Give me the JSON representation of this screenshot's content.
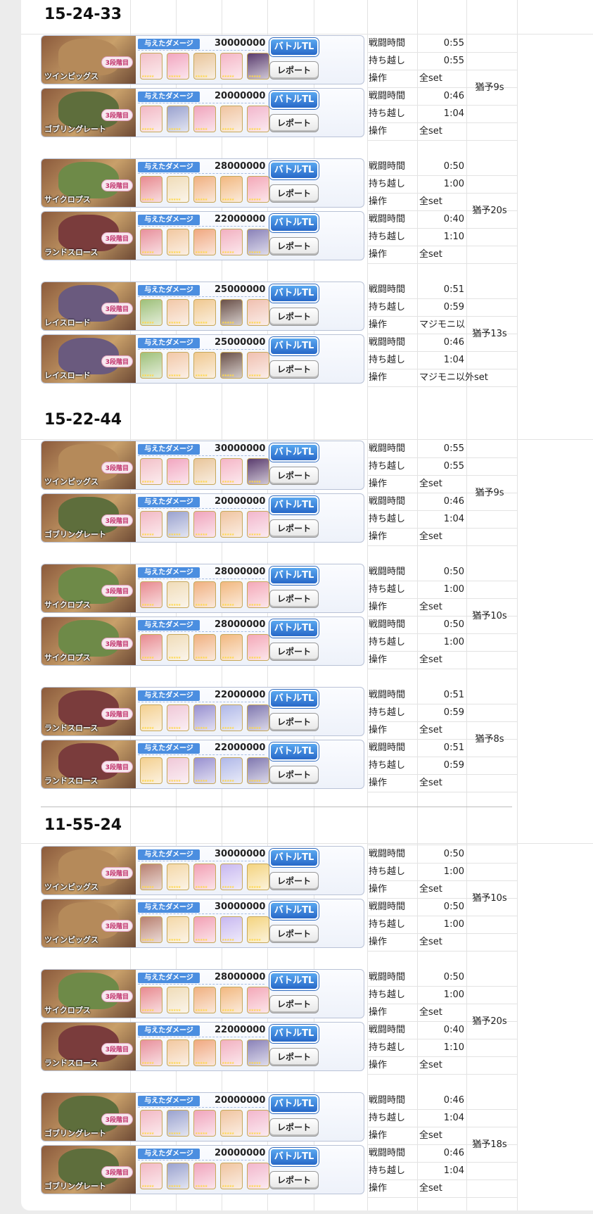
{
  "blocks": [
    {
      "title": "15-24-33",
      "groups": [
        {
          "note": "猶予9s",
          "entries": [
            {
              "boss": "ツインピッグス",
              "stage": "3段階目",
              "damage_label": "与えたダメージ",
              "damage": "30000000",
              "tl_label": "バトルTL",
              "report_label": "レポート",
              "labels": [
                "戦闘時間",
                "持ち越し",
                "操作"
              ],
              "battle_time": "0:55",
              "carryover": "0:55",
              "operation": "全set",
              "boss_color": "#b58a5a",
              "chars": [
                "#f3c0c8",
                "#f2a6c0",
                "#e9c59a",
                "#f5b5c6",
                "#5a3c6e"
              ]
            },
            {
              "boss": "ゴブリングレート",
              "stage": "3段階目",
              "damage_label": "与えたダメージ",
              "damage": "20000000",
              "tl_label": "バトルTL",
              "report_label": "レポート",
              "labels": [
                "戦闘時間",
                "持ち越し",
                "操作"
              ],
              "battle_time": "0:46",
              "carryover": "1:04",
              "operation": "全set",
              "boss_color": "#5e6e3c",
              "chars": [
                "#f2b8c4",
                "#9aa2cf",
                "#f0a4bc",
                "#f0c4a0",
                "#f2b6cc"
              ]
            }
          ]
        },
        {
          "note": "猶予20s",
          "entries": [
            {
              "boss": "サイクロプス",
              "stage": "3段階目",
              "damage_label": "与えたダメージ",
              "damage": "28000000",
              "tl_label": "バトルTL",
              "report_label": "レポート",
              "labels": [
                "戦闘時間",
                "持ち越し",
                "操作"
              ],
              "battle_time": "0:50",
              "carryover": "1:00",
              "operation": "全set",
              "boss_color": "#6e8a48",
              "chars": [
                "#e88a90",
                "#f0dcb8",
                "#f0b080",
                "#f2b880",
                "#f4a8b8"
              ]
            },
            {
              "boss": "ランドスロース",
              "stage": "3段階目",
              "damage_label": "与えたダメージ",
              "damage": "22000000",
              "tl_label": "バトルTL",
              "report_label": "レポート",
              "labels": [
                "戦闘時間",
                "持ち越し",
                "操作"
              ],
              "battle_time": "0:40",
              "carryover": "1:10",
              "operation": "全set",
              "boss_color": "#7a3c3c",
              "chars": [
                "#e8909c",
                "#f2c8a0",
                "#f0a880",
                "#f2b0c0",
                "#8a82b8"
              ]
            }
          ]
        },
        {
          "note": "猶予13s",
          "entries": [
            {
              "boss": "レイスロード",
              "stage": "3段階目",
              "damage_label": "与えたダメージ",
              "damage": "25000000",
              "tl_label": "バトルTL",
              "report_label": "レポート",
              "labels": [
                "戦闘時間",
                "持ち越し",
                "操作"
              ],
              "battle_time": "0:51",
              "carryover": "0:59",
              "operation": "マジモニ以",
              "boss_color": "#6a5a7e",
              "chars": [
                "#9ec07a",
                "#f2c8a8",
                "#f0c890",
                "#6a5048",
                "#f0c0b0"
              ]
            },
            {
              "boss": "レイスロード",
              "stage": "3段階目",
              "damage_label": "与えたダメージ",
              "damage": "25000000",
              "tl_label": "バトルTL",
              "report_label": "レポート",
              "labels": [
                "戦闘時間",
                "持ち越し",
                "操作"
              ],
              "battle_time": "0:46",
              "carryover": "1:04",
              "operation": "マジモニ以外set",
              "boss_color": "#6a5a7e",
              "chars": [
                "#9ec07a",
                "#f2c8a8",
                "#f0c890",
                "#6a5048",
                "#f0c0b0"
              ]
            }
          ]
        }
      ]
    },
    {
      "title": "15-22-44",
      "groups": [
        {
          "note": "猶予9s",
          "entries": [
            {
              "boss": "ツインピッグス",
              "stage": "3段階目",
              "damage_label": "与えたダメージ",
              "damage": "30000000",
              "tl_label": "バトルTL",
              "report_label": "レポート",
              "labels": [
                "戦闘時間",
                "持ち越し",
                "操作"
              ],
              "battle_time": "0:55",
              "carryover": "0:55",
              "operation": "全set",
              "boss_color": "#b58a5a",
              "chars": [
                "#f3c0c8",
                "#f2a6c0",
                "#e9c59a",
                "#f5b5c6",
                "#5a3c6e"
              ]
            },
            {
              "boss": "ゴブリングレート",
              "stage": "3段階目",
              "damage_label": "与えたダメージ",
              "damage": "20000000",
              "tl_label": "バトルTL",
              "report_label": "レポート",
              "labels": [
                "戦闘時間",
                "持ち越し",
                "操作"
              ],
              "battle_time": "0:46",
              "carryover": "1:04",
              "operation": "全set",
              "boss_color": "#5e6e3c",
              "chars": [
                "#f2b8c4",
                "#9aa2cf",
                "#f0a4bc",
                "#f0c4a0",
                "#f2b6cc"
              ]
            }
          ]
        },
        {
          "note": "猶予10s",
          "entries": [
            {
              "boss": "サイクロプス",
              "stage": "3段階目",
              "damage_label": "与えたダメージ",
              "damage": "28000000",
              "tl_label": "バトルTL",
              "report_label": "レポート",
              "labels": [
                "戦闘時間",
                "持ち越し",
                "操作"
              ],
              "battle_time": "0:50",
              "carryover": "1:00",
              "operation": "全set",
              "boss_color": "#6e8a48",
              "chars": [
                "#e88a90",
                "#f0dcb8",
                "#f0b080",
                "#f2b880",
                "#f4a8b8"
              ]
            },
            {
              "boss": "サイクロプス",
              "stage": "3段階目",
              "damage_label": "与えたダメージ",
              "damage": "28000000",
              "tl_label": "バトルTL",
              "report_label": "レポート",
              "labels": [
                "戦闘時間",
                "持ち越し",
                "操作"
              ],
              "battle_time": "0:50",
              "carryover": "1:00",
              "operation": "全set",
              "boss_color": "#6e8a48",
              "chars": [
                "#e88a90",
                "#f0dcb8",
                "#f0b080",
                "#f2b880",
                "#f4a8b8"
              ]
            }
          ]
        },
        {
          "note": "猶予8s",
          "entries": [
            {
              "boss": "ランドスロース",
              "stage": "3段階目",
              "damage_label": "与えたダメージ",
              "damage": "22000000",
              "tl_label": "バトルTL",
              "report_label": "レポート",
              "labels": [
                "戦闘時間",
                "持ち越し",
                "操作"
              ],
              "battle_time": "0:51",
              "carryover": "0:59",
              "operation": "全set",
              "boss_color": "#7a3c3c",
              "chars": [
                "#f4d090",
                "#f0c8d8",
                "#9890d0",
                "#b0b8e8",
                "#8078b0"
              ]
            },
            {
              "boss": "ランドスロース",
              "stage": "3段階目",
              "damage_label": "与えたダメージ",
              "damage": "22000000",
              "tl_label": "バトルTL",
              "report_label": "レポート",
              "labels": [
                "戦闘時間",
                "持ち越し",
                "操作"
              ],
              "battle_time": "0:51",
              "carryover": "0:59",
              "operation": "全set",
              "boss_color": "#7a3c3c",
              "chars": [
                "#f4d090",
                "#f0c8d8",
                "#9890d0",
                "#b0b8e8",
                "#8078b0"
              ]
            }
          ]
        }
      ]
    },
    {
      "title": "11-55-24",
      "groups": [
        {
          "note": "猶予10s",
          "entries": [
            {
              "boss": "ツインピッグス",
              "stage": "3段階目",
              "damage_label": "与えたダメージ",
              "damage": "30000000",
              "tl_label": "バトルTL",
              "report_label": "レポート",
              "labels": [
                "戦闘時間",
                "持ち越し",
                "操作"
              ],
              "battle_time": "0:50",
              "carryover": "1:00",
              "operation": "全set",
              "boss_color": "#b58a5a",
              "chars": [
                "#b88070",
                "#f4d8a8",
                "#f2a0b4",
                "#c8b8f0",
                "#f4d480"
              ]
            },
            {
              "boss": "ツインピッグス",
              "stage": "3段階目",
              "damage_label": "与えたダメージ",
              "damage": "30000000",
              "tl_label": "バトルTL",
              "report_label": "レポート",
              "labels": [
                "戦闘時間",
                "持ち越し",
                "操作"
              ],
              "battle_time": "0:50",
              "carryover": "1:00",
              "operation": "全set",
              "boss_color": "#b58a5a",
              "chars": [
                "#b88070",
                "#f4d8a8",
                "#f2a0b4",
                "#c8b8f0",
                "#f4d480"
              ]
            }
          ]
        },
        {
          "note": "猶予20s",
          "entries": [
            {
              "boss": "サイクロプス",
              "stage": "3段階目",
              "damage_label": "与えたダメージ",
              "damage": "28000000",
              "tl_label": "バトルTL",
              "report_label": "レポート",
              "labels": [
                "戦闘時間",
                "持ち越し",
                "操作"
              ],
              "battle_time": "0:50",
              "carryover": "1:00",
              "operation": "全set",
              "boss_color": "#6e8a48",
              "chars": [
                "#e88a90",
                "#f0dcb8",
                "#f0b080",
                "#f2b880",
                "#f4a8b8"
              ]
            },
            {
              "boss": "ランドスロース",
              "stage": "3段階目",
              "damage_label": "与えたダメージ",
              "damage": "22000000",
              "tl_label": "バトルTL",
              "report_label": "レポート",
              "labels": [
                "戦闘時間",
                "持ち越し",
                "操作"
              ],
              "battle_time": "0:40",
              "carryover": "1:10",
              "operation": "全set",
              "boss_color": "#7a3c3c",
              "chars": [
                "#e8909c",
                "#f2c8a0",
                "#f0a880",
                "#f2b0c0",
                "#8a82b8"
              ]
            }
          ]
        },
        {
          "note": "猶予18s",
          "entries": [
            {
              "boss": "ゴブリングレート",
              "stage": "3段階目",
              "damage_label": "与えたダメージ",
              "damage": "20000000",
              "tl_label": "バトルTL",
              "report_label": "レポート",
              "labels": [
                "戦闘時間",
                "持ち越し",
                "操作"
              ],
              "battle_time": "0:46",
              "carryover": "1:04",
              "operation": "全set",
              "boss_color": "#5e6e3c",
              "chars": [
                "#f2b8c4",
                "#9aa2cf",
                "#f0a4bc",
                "#f0c4a0",
                "#f2b6cc"
              ]
            },
            {
              "boss": "ゴブリングレート",
              "stage": "3段階目",
              "damage_label": "与えたダメージ",
              "damage": "20000000",
              "tl_label": "バトルTL",
              "report_label": "レポート",
              "labels": [
                "戦闘時間",
                "持ち越し",
                "操作"
              ],
              "battle_time": "0:46",
              "carryover": "1:04",
              "operation": "全set",
              "boss_color": "#5e6e3c",
              "chars": [
                "#f2b8c4",
                "#9aa2cf",
                "#f0a4bc",
                "#f0c4a0",
                "#f2b6cc"
              ]
            }
          ]
        }
      ]
    }
  ]
}
